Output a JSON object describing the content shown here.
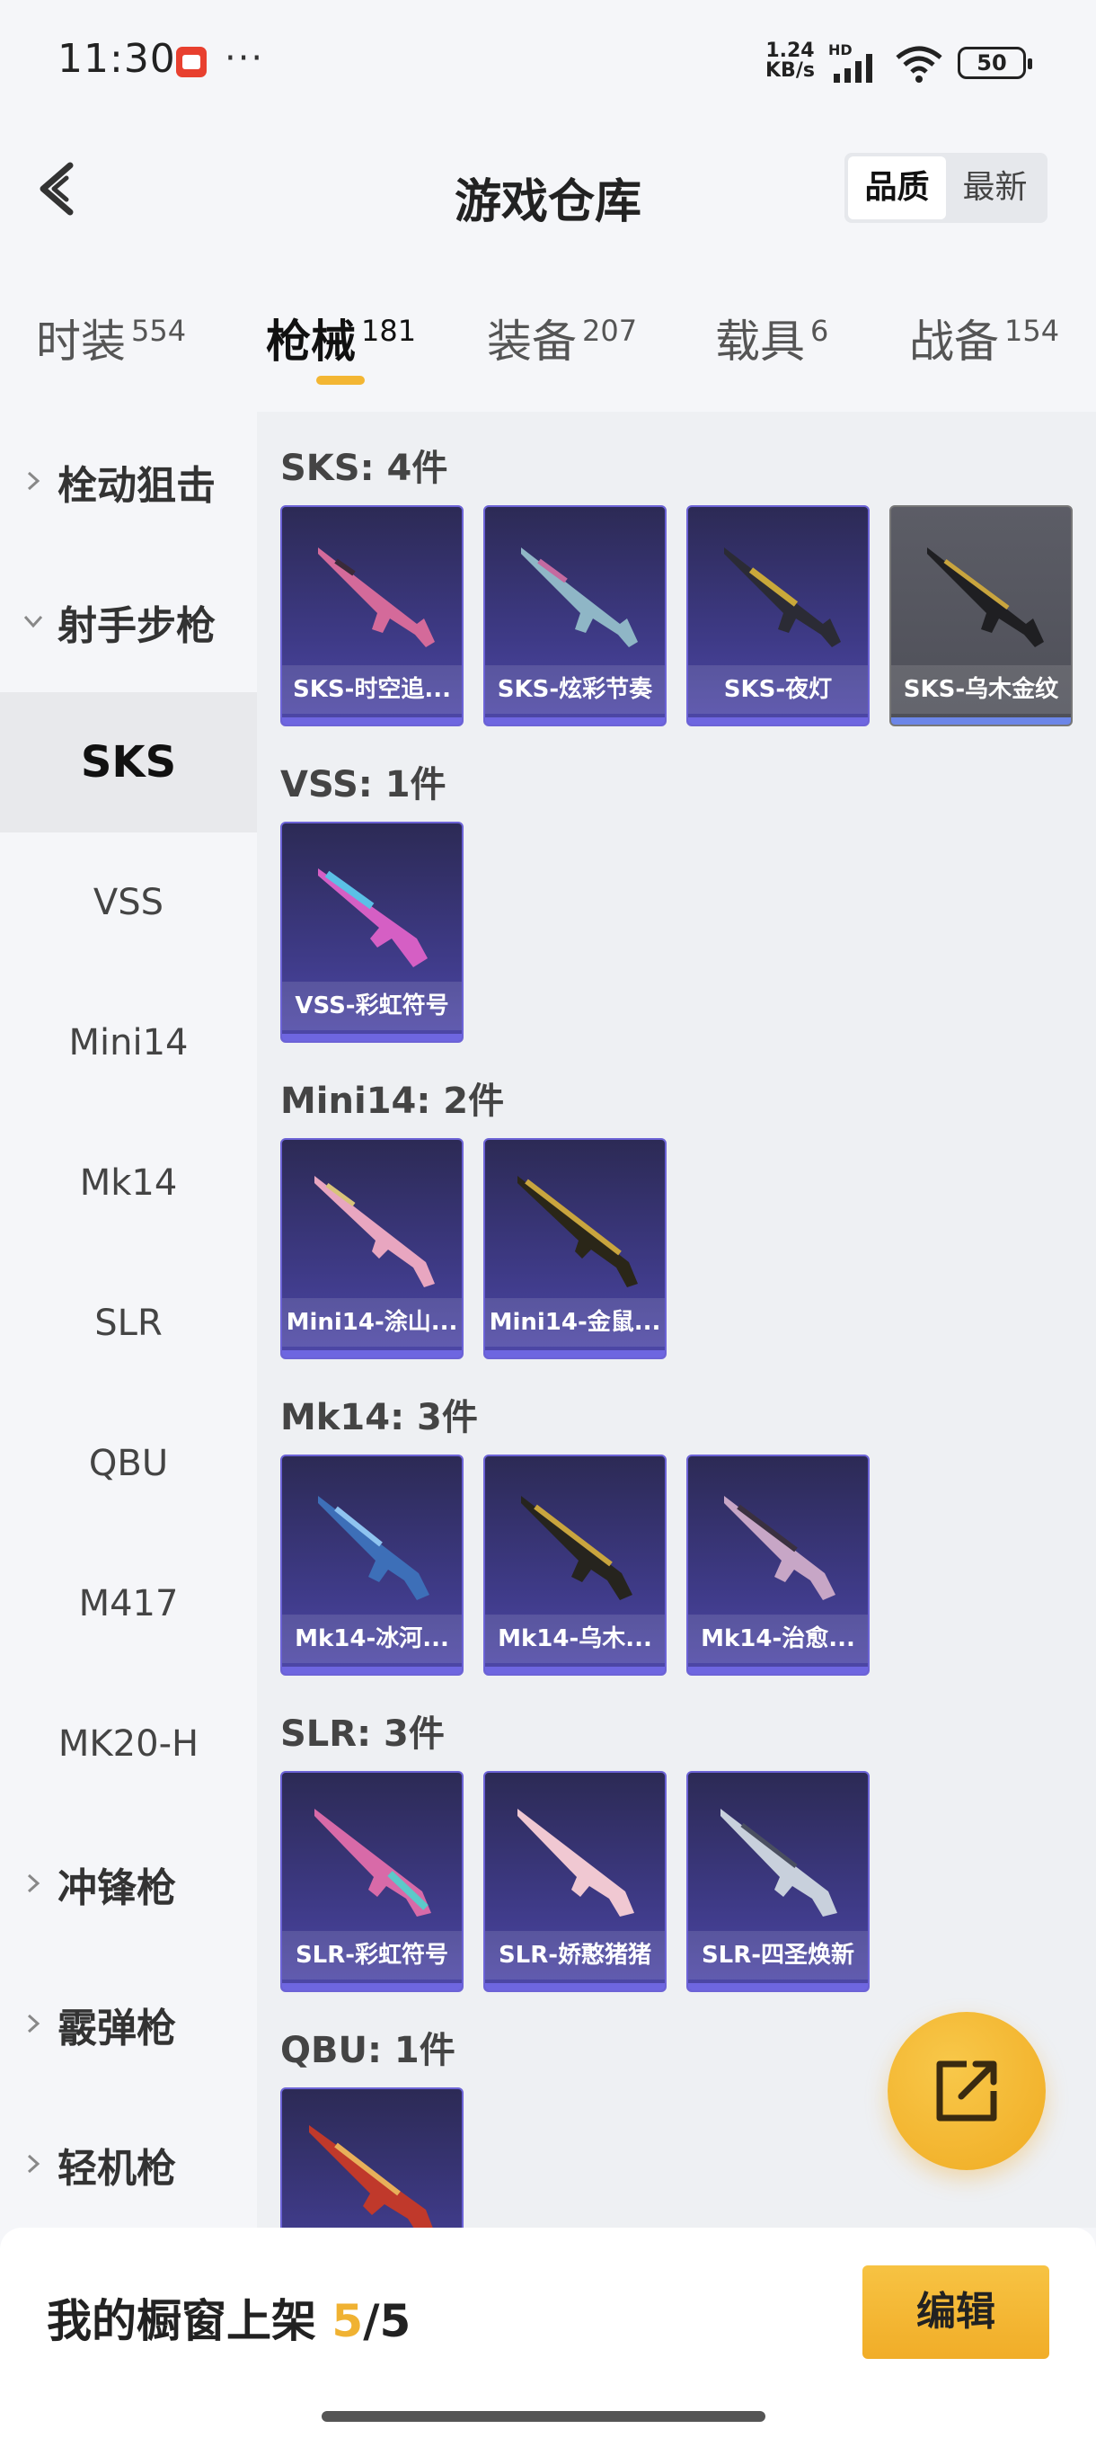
{
  "status_bar": {
    "time": "11:30",
    "dots": "···",
    "net_speed_value": "1.24",
    "net_speed_unit": "KB/s",
    "hd": "HD",
    "battery": "50"
  },
  "header": {
    "title": "游戏仓库",
    "sort": [
      "品质",
      "最新"
    ],
    "sort_active": "品质"
  },
  "tabs": [
    {
      "label": "时装",
      "count": "554"
    },
    {
      "label": "枪械",
      "count": "181"
    },
    {
      "label": "装备",
      "count": "207"
    },
    {
      "label": "载具",
      "count": "6"
    },
    {
      "label": "战备",
      "count": "154"
    }
  ],
  "sidebar": {
    "groups": [
      "栓动狙击",
      "射手步枪",
      "冲锋枪",
      "霰弹枪",
      "轻机枪"
    ],
    "subitems": [
      "SKS",
      "VSS",
      "Mini14",
      "Mk14",
      "SLR",
      "QBU",
      "M417",
      "MK20-H"
    ],
    "active": "SKS"
  },
  "sections": [
    {
      "title": "SKS: 4件",
      "items": [
        "SKS-时空追...",
        "SKS-炫彩节奏",
        "SKS-夜灯",
        "SKS-乌木金纹"
      ]
    },
    {
      "title": "VSS: 1件",
      "items": [
        "VSS-彩虹符号"
      ]
    },
    {
      "title": "Mini14: 2件",
      "items": [
        "Mini14-涂山...",
        "Mini14-金鼠..."
      ]
    },
    {
      "title": "Mk14: 3件",
      "items": [
        "Mk14-冰河...",
        "Mk14-乌木...",
        "Mk14-治愈..."
      ]
    },
    {
      "title": "SLR: 3件",
      "items": [
        "SLR-彩虹符号",
        "SLR-娇憨猪猪",
        "SLR-四圣焕新"
      ]
    },
    {
      "title": "QBU: 1件",
      "items": [
        ""
      ]
    }
  ],
  "bottom": {
    "label": "我的橱窗上架",
    "current": "5",
    "total": "/5",
    "edit_label": "编辑"
  },
  "colors": {
    "accent": "#f3b633",
    "card_bg": "#3e3a86",
    "card_border": "#6c63d6"
  }
}
